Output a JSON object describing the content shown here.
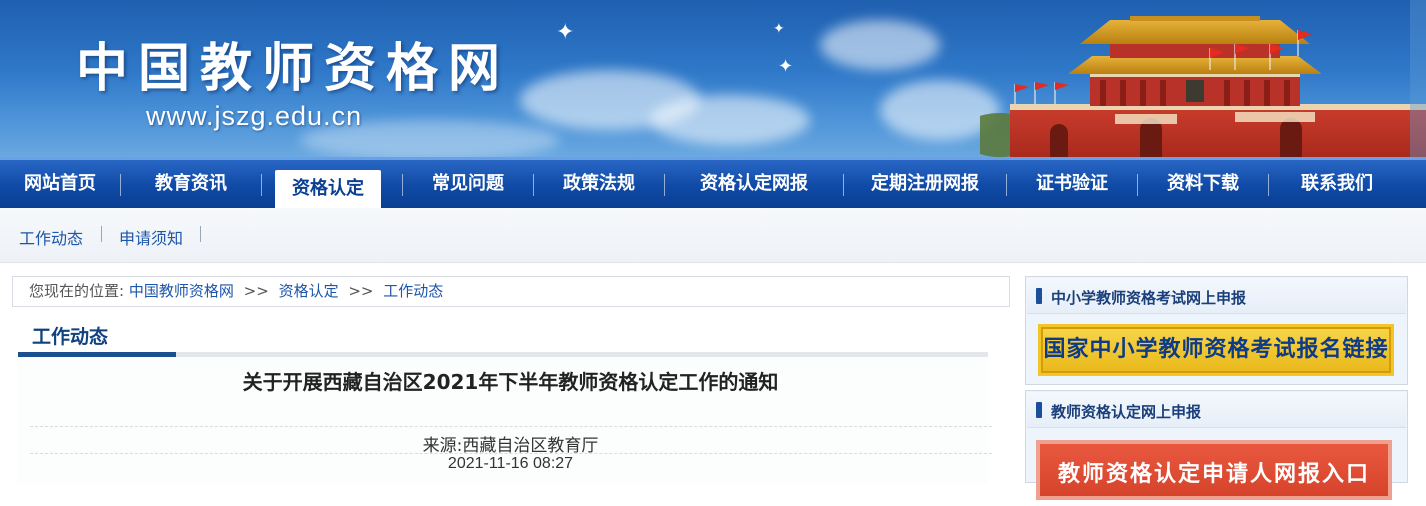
{
  "banner": {
    "title": "中国教师资格网",
    "url": "www.jszg.edu.cn"
  },
  "mainnav": {
    "items": [
      {
        "label": "网站首页"
      },
      {
        "label": "教育资讯"
      },
      {
        "label": "资格认定",
        "active": true
      },
      {
        "label": "常见问题"
      },
      {
        "label": "政策法规"
      },
      {
        "label": "资格认定网报"
      },
      {
        "label": "定期注册网报"
      },
      {
        "label": "证书验证"
      },
      {
        "label": "资料下载"
      },
      {
        "label": "联系我们"
      }
    ]
  },
  "subnav": {
    "items": [
      {
        "label": "工作动态"
      },
      {
        "label": "申请须知"
      }
    ]
  },
  "breadcrumb": {
    "prefix": "您现在的位置:",
    "links": [
      "中国教师资格网",
      "资格认定",
      "工作动态"
    ],
    "separator": ">>"
  },
  "section": {
    "title": "工作动态"
  },
  "article": {
    "title": "关于开展西藏自治区2021年下半年教师资格认定工作的通知",
    "source": "来源:西藏自治区教育厅",
    "date": "2021-11-16 08:27"
  },
  "sidebar": {
    "exam_header": "中小学教师资格考试网上申报",
    "exam_button": "国家中小学教师资格考试报名链接",
    "cert_header": "教师资格认定网上申报",
    "cert_button": "教师资格认定申请人网报入口"
  },
  "colors": {
    "nav_blue": "#0f4aa6",
    "link_blue": "#1d55a8",
    "accent_yellow": "#f2c52a",
    "accent_red": "#d6432b"
  }
}
